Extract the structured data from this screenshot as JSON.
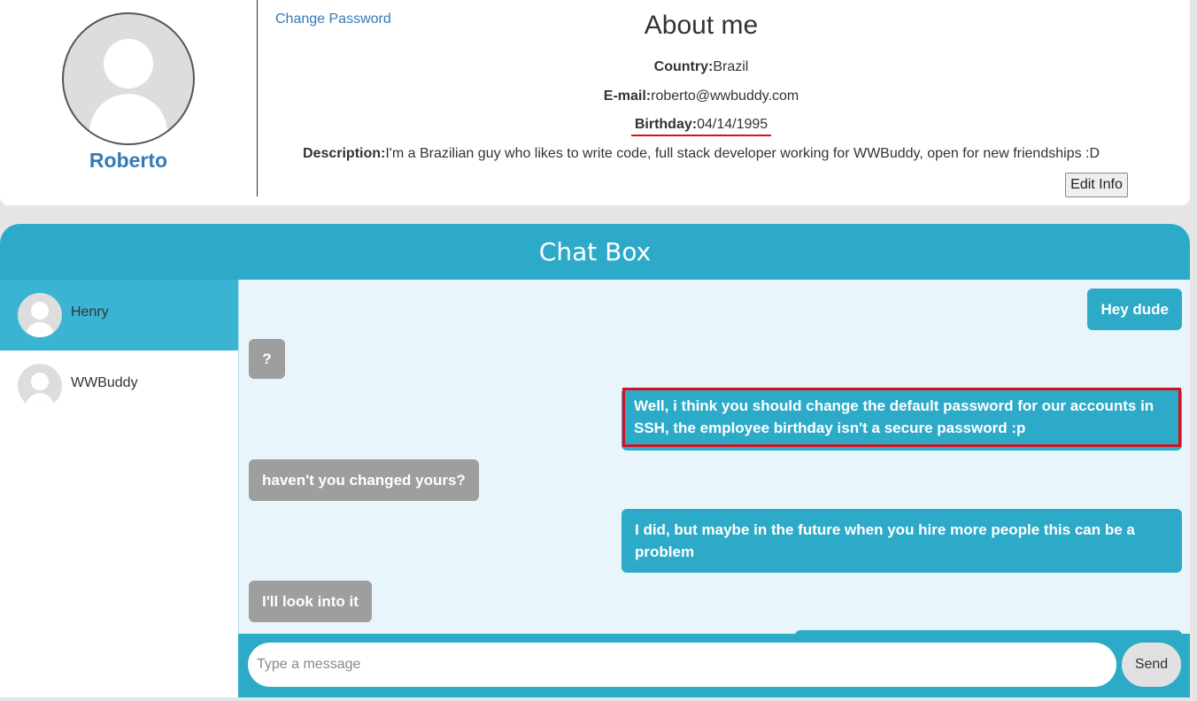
{
  "profile": {
    "username": "Roberto",
    "change_password_label": "Change Password",
    "about_title": "About me",
    "country_label": "Country:",
    "country_value": "Brazil",
    "email_label": "E-mail:",
    "email_value": "roberto@wwbuddy.com",
    "birthday_label": "Birthday:",
    "birthday_value": "04/14/1995",
    "description_label": "Description:",
    "description_value": "I'm a Brazilian guy who likes to write code, full stack developer working for WWBuddy, open for new friendships :D",
    "edit_info_label": "Edit Info"
  },
  "chat": {
    "title": "Chat Box",
    "contacts": [
      {
        "name": "Henry",
        "active": true
      },
      {
        "name": "WWBuddy",
        "active": false
      }
    ],
    "messages": [
      {
        "direction": "out",
        "text": "Hey dude"
      },
      {
        "direction": "in",
        "text": "?"
      },
      {
        "direction": "out",
        "text": "Well, i think you should change the default password for our accounts in SSH, the employee birthday isn't a secure password :p",
        "highlighted": true
      },
      {
        "direction": "in",
        "text": "haven't you changed yours?"
      },
      {
        "direction": "out",
        "text": "I did, but maybe in the future when you hire more people this can be a problem"
      },
      {
        "direction": "in",
        "text": "I'll look into it"
      }
    ],
    "input_placeholder": "Type a message",
    "send_label": "Send"
  },
  "colors": {
    "accent": "#2eaac9",
    "active_contact": "#3ab4d2",
    "incoming_bubble": "#9e9e9e",
    "link": "#337ab7",
    "highlight_annotation": "#d4111d"
  }
}
